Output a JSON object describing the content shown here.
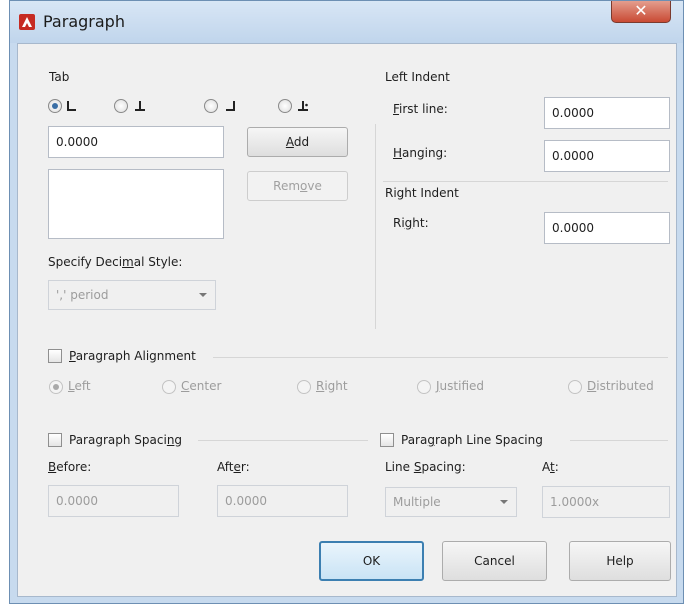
{
  "window": {
    "title": "Paragraph",
    "close_label": "✕"
  },
  "tab_section": {
    "label": "Tab",
    "tab_value": "0.0000",
    "add_mn": "A",
    "add_rest": "dd",
    "remove_a": "Rem",
    "remove_mn": "o",
    "remove_b": "ve",
    "decimal_a": "Specify Deci",
    "decimal_mn": "m",
    "decimal_b": "al Style:",
    "decimal_value": "',' period"
  },
  "left_indent": {
    "label": "Left Indent",
    "first_mn": "F",
    "first_rest": "irst line:",
    "first_value": "0.0000",
    "hanging_mn": "H",
    "hanging_rest": "anging:",
    "hanging_value": "0.0000"
  },
  "right_indent": {
    "label": "Right Indent",
    "right_a": "Ri",
    "right_mn": "g",
    "right_b": "ht:",
    "right_value": "0.0000"
  },
  "alignment": {
    "mn": "P",
    "rest": "aragraph Alignment",
    "left_mn": "L",
    "left_rest": "eft",
    "center_mn": "C",
    "center_rest": "enter",
    "right_mn": "R",
    "right_rest": "ight",
    "justified_mn": "J",
    "justified_rest": "ustified",
    "distributed_mn": "D",
    "distributed_rest": "istributed"
  },
  "spacing": {
    "label_a": "Paragraph Spaci",
    "label_mn": "n",
    "label_b": "g",
    "before_mn": "B",
    "before_rest": "efore:",
    "after_a": "Aft",
    "after_mn": "e",
    "after_b": "r:",
    "before_value": "0.0000",
    "after_value": "0.0000"
  },
  "line_spacing": {
    "label_a": "Para",
    "label_mn": "g",
    "label_b": "raph Line Spacing",
    "ls_a": "Line ",
    "ls_mn": "S",
    "ls_b": "pacing:",
    "at_a": "A",
    "at_mn": "t",
    "at_b": ":",
    "mode_value": "Multiple",
    "at_value": "1.0000x"
  },
  "buttons": {
    "ok": "OK",
    "cancel": "Cancel",
    "help": "Help"
  }
}
